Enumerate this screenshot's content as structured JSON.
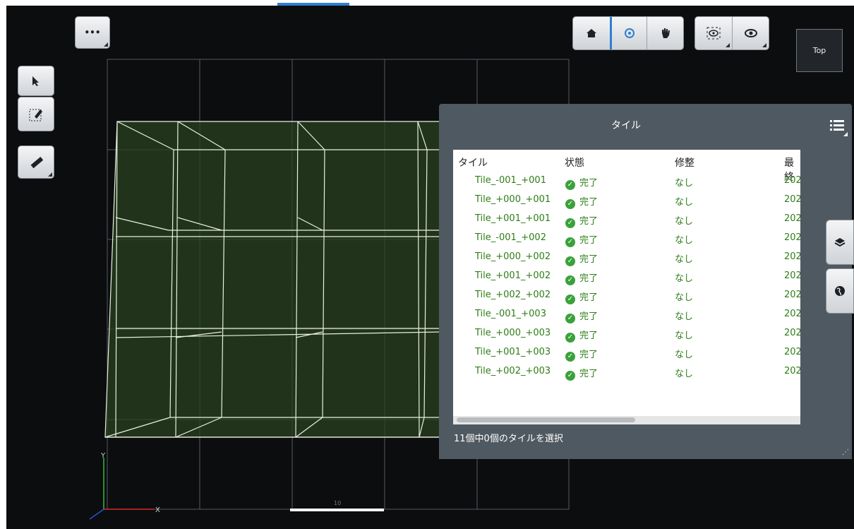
{
  "toolbar": {
    "more_label": "•••",
    "home_icon": "home-icon",
    "orbit_icon": "orbit-icon",
    "pan_icon": "hand-icon",
    "fit_icon": "focus-view-icon",
    "eye_icon": "eye-icon",
    "active_color": "#2d7fd3"
  },
  "left_tools": {
    "select_icon": "cursor-icon",
    "edit_icon": "edit-region-icon",
    "measure_icon": "ruler-icon"
  },
  "view_cube": {
    "label": "Top"
  },
  "scale_bar": {
    "label": "10"
  },
  "axes": {
    "y_label": "Y",
    "x_label": "X"
  },
  "panel": {
    "title": "タイル",
    "menu_icon": "list-icon",
    "columns": [
      "タイル",
      "状態",
      "修整",
      "最終"
    ],
    "rows": [
      {
        "tile": "Tile_-001_+001",
        "status": "完了",
        "fix": "なし",
        "last": "202"
      },
      {
        "tile": "Tile_+000_+001",
        "status": "完了",
        "fix": "なし",
        "last": "202"
      },
      {
        "tile": "Tile_+001_+001",
        "status": "完了",
        "fix": "なし",
        "last": "202"
      },
      {
        "tile": "Tile_-001_+002",
        "status": "完了",
        "fix": "なし",
        "last": "202"
      },
      {
        "tile": "Tile_+000_+002",
        "status": "完了",
        "fix": "なし",
        "last": "202"
      },
      {
        "tile": "Tile_+001_+002",
        "status": "完了",
        "fix": "なし",
        "last": "202"
      },
      {
        "tile": "Tile_+002_+002",
        "status": "完了",
        "fix": "なし",
        "last": "202"
      },
      {
        "tile": "Tile_-001_+003",
        "status": "完了",
        "fix": "なし",
        "last": "202"
      },
      {
        "tile": "Tile_+000_+003",
        "status": "完了",
        "fix": "なし",
        "last": "202"
      },
      {
        "tile": "Tile_+001_+003",
        "status": "完了",
        "fix": "なし",
        "last": "202"
      },
      {
        "tile": "Tile_+002_+003",
        "status": "完了",
        "fix": "なし",
        "last": "202"
      }
    ],
    "status_text": "11個中0個のタイルを選択",
    "status_color": "#2e7d16"
  },
  "side_tabs": {
    "layers_icon": "layers-icon",
    "globe_icon": "globe-icon"
  }
}
